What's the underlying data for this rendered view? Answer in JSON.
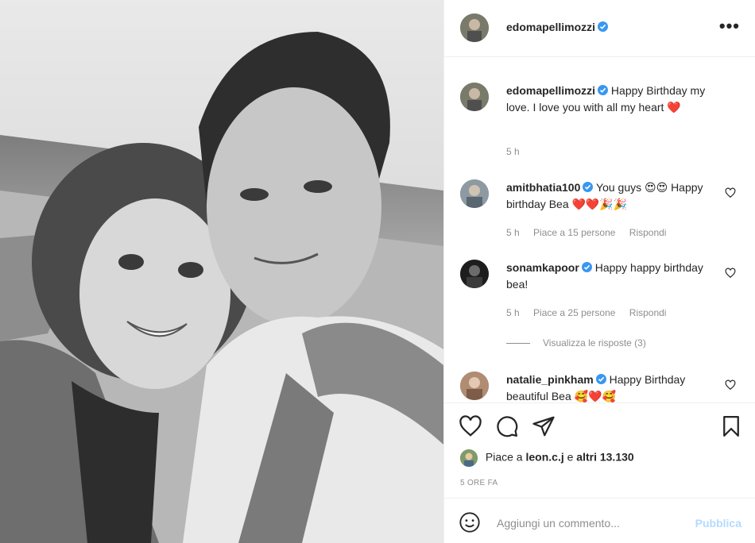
{
  "post": {
    "username": "edomapellimozzi",
    "more_icon": "more-icon",
    "caption": {
      "username": "edomapellimozzi",
      "text": "Happy Birthday my love. I love you with all my heart",
      "emoji": "❤️",
      "time": "5 h"
    }
  },
  "comments": [
    {
      "username": "amitbhatia100",
      "text": "You guys 😍😍 Happy birthday Bea ❤️❤️🎉🎉",
      "time": "5 h",
      "likes": "Piace a 15 persone",
      "reply": "Rispondi"
    },
    {
      "username": "sonamkapoor",
      "text": "Happy happy birthday bea!",
      "time": "5 h",
      "likes": "Piace a 25 persone",
      "reply": "Rispondi"
    },
    {
      "username": "natalie_pinkham",
      "text": "Happy Birthday beautiful Bea 🥰❤️🥰"
    }
  ],
  "view_replies": "Visualizza le risposte (3)",
  "likes_line": {
    "prefix": "Piace a",
    "user": "leon.c.j",
    "middle": "e",
    "others": "altri 13.130"
  },
  "timestamp": "5 ORE FA",
  "add_comment": {
    "placeholder": "Aggiungi un commento...",
    "publish": "Pubblica"
  },
  "colors": {
    "verified": "#3897f0",
    "publish": "#b3dbff",
    "muted": "#8e8e8e"
  }
}
